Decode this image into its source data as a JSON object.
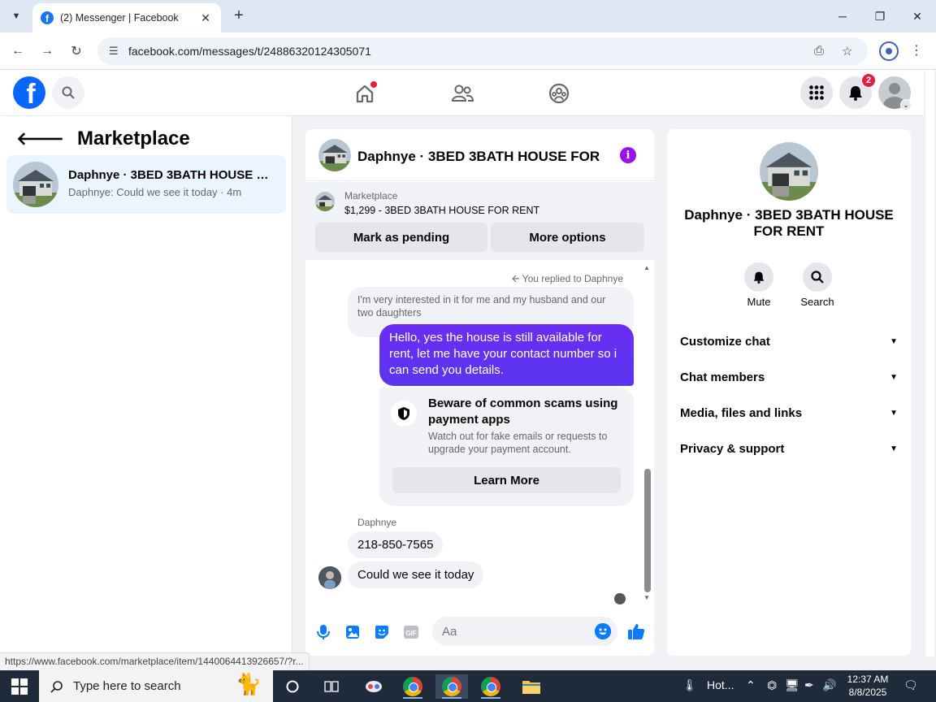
{
  "browser": {
    "tab_title": "(2) Messenger | Facebook",
    "url": "facebook.com/messages/t/24886320124305071",
    "status_url": "https://www.facebook.com/marketplace/item/1440064413926657/?r..."
  },
  "fb_header": {
    "notification_count": "2",
    "icons": [
      "facebook-logo",
      "search-icon",
      "home-icon",
      "friends-icon",
      "groups-icon",
      "menu-grid-icon",
      "bell-icon",
      "account-avatar"
    ]
  },
  "sidebar": {
    "title": "Marketplace",
    "conversations": [
      {
        "name": "Daphnye · 3BED 3BATH HOUSE FOR RENT",
        "snippet": "Daphnye: Could we see it today · 4m"
      }
    ]
  },
  "chat": {
    "title": "Daphnye · 3BED 3BATH HOUSE FOR ...",
    "marketplace_label": "Marketplace",
    "listing": "$1,299 - 3BED 3BATH HOUSE FOR RENT",
    "mark_pending_label": "Mark as pending",
    "more_options_label": "More options",
    "replied_note": "You replied to Daphnye",
    "quoted_message": "I'm very interested in it for me and my husband and our two daughters",
    "outgoing_message": "Hello, yes the house is still available for rent, let me have your contact number so i can send you details.",
    "warning": {
      "heading": "Beware of common scams using payment apps",
      "body": "Watch out for fake emails or requests to upgrade your payment account.",
      "button": "Learn More"
    },
    "sender_name": "Daphnye",
    "incoming": [
      "218-850-7565",
      "Could we see it today"
    ],
    "composer_placeholder": "Aa"
  },
  "info_panel": {
    "name": "Daphnye · 3BED 3BATH HOUSE FOR RENT",
    "actions": [
      "Mute",
      "Search"
    ],
    "sections": [
      "Customize chat",
      "Chat members",
      "Media, files and links",
      "Privacy & support"
    ]
  },
  "taskbar": {
    "search_placeholder": "Type here to search",
    "weather": "Hot...",
    "time": "12:37 AM",
    "date": "8/8/2025"
  },
  "colors": {
    "facebook_blue": "#0866ff",
    "outgoing_bubble": "#5b35f0",
    "info_purple": "#9b10ef",
    "highlight_row": "#ebf5ff"
  }
}
